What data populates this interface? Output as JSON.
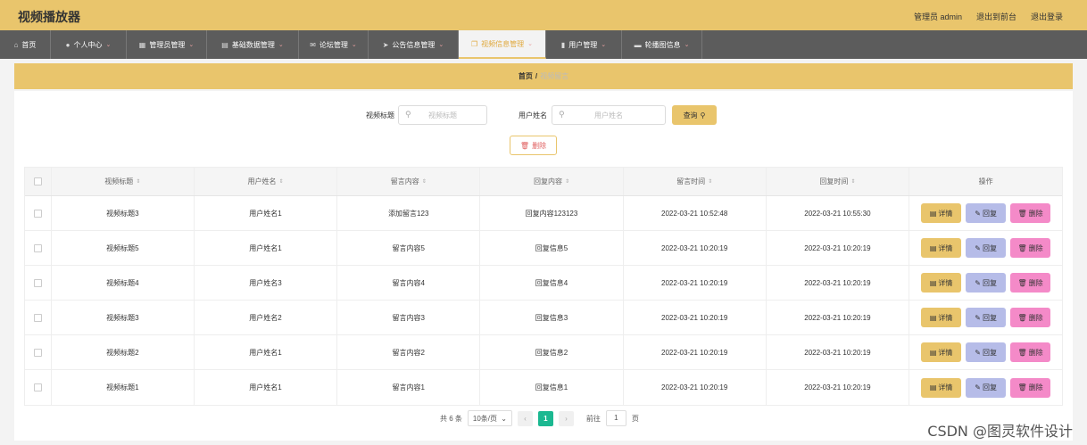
{
  "app": {
    "title": "视频播放器"
  },
  "top_right": {
    "admin": "管理员 admin",
    "front": "退出到前台",
    "logout": "退出登录"
  },
  "nav": [
    {
      "label": "首页",
      "icon": "home-icon",
      "glyph": "⌂"
    },
    {
      "label": "个人中心",
      "icon": "user-icon",
      "glyph": "●"
    },
    {
      "label": "管理员管理",
      "icon": "grid-icon",
      "glyph": "▦"
    },
    {
      "label": "基础数据管理",
      "icon": "database-icon",
      "glyph": "▤"
    },
    {
      "label": "论坛管理",
      "icon": "mail-icon",
      "glyph": "✉"
    },
    {
      "label": "公告信息管理",
      "icon": "send-icon",
      "glyph": "➤"
    },
    {
      "label": "视频信息管理",
      "icon": "copy-icon",
      "glyph": "❐"
    },
    {
      "label": "用户管理",
      "icon": "bar-chart-icon",
      "glyph": "▮"
    },
    {
      "label": "轮播图信息",
      "icon": "car-icon",
      "glyph": "▬"
    }
  ],
  "breadcrumb": {
    "home": "首页",
    "sep": "/",
    "current": "视频留言"
  },
  "search": {
    "title_label": "视频标题",
    "title_placeholder": "视频标题",
    "user_label": "用户姓名",
    "user_placeholder": "用户姓名",
    "query_label": "查询"
  },
  "bulk_delete_label": "删除",
  "table": {
    "headers": [
      "视频标题",
      "用户姓名",
      "留言内容",
      "回复内容",
      "留言时间",
      "回复时间",
      "操作"
    ],
    "rows": [
      [
        "视频标题3",
        "用户姓名1",
        "添加留言123",
        "回复内容123123",
        "2022-03-21 10:52:48",
        "2022-03-21 10:55:30"
      ],
      [
        "视频标题5",
        "用户姓名1",
        "留言内容5",
        "回复信息5",
        "2022-03-21 10:20:19",
        "2022-03-21 10:20:19"
      ],
      [
        "视频标题4",
        "用户姓名3",
        "留言内容4",
        "回复信息4",
        "2022-03-21 10:20:19",
        "2022-03-21 10:20:19"
      ],
      [
        "视频标题3",
        "用户姓名2",
        "留言内容3",
        "回复信息3",
        "2022-03-21 10:20:19",
        "2022-03-21 10:20:19"
      ],
      [
        "视频标题2",
        "用户姓名1",
        "留言内容2",
        "回复信息2",
        "2022-03-21 10:20:19",
        "2022-03-21 10:20:19"
      ],
      [
        "视频标题1",
        "用户姓名1",
        "留言内容1",
        "回复信息1",
        "2022-03-21 10:20:19",
        "2022-03-21 10:20:19"
      ]
    ],
    "actions": {
      "detail": "详情",
      "reply": "回复",
      "delete": "删除"
    }
  },
  "pagination": {
    "total": "共 6 条",
    "page_size": "10条/页",
    "current_page": "1",
    "goto_label": "前往",
    "goto_value": "1",
    "page_unit": "页"
  },
  "watermark": "CSDN @图灵软件设计",
  "colors": {
    "topbar": "#e9c56c",
    "navbar": "#5c5c5c",
    "detail": "#e9c56c",
    "reply": "#b6bce8",
    "delete": "#f48ac8",
    "page_active": "#1bb891"
  }
}
